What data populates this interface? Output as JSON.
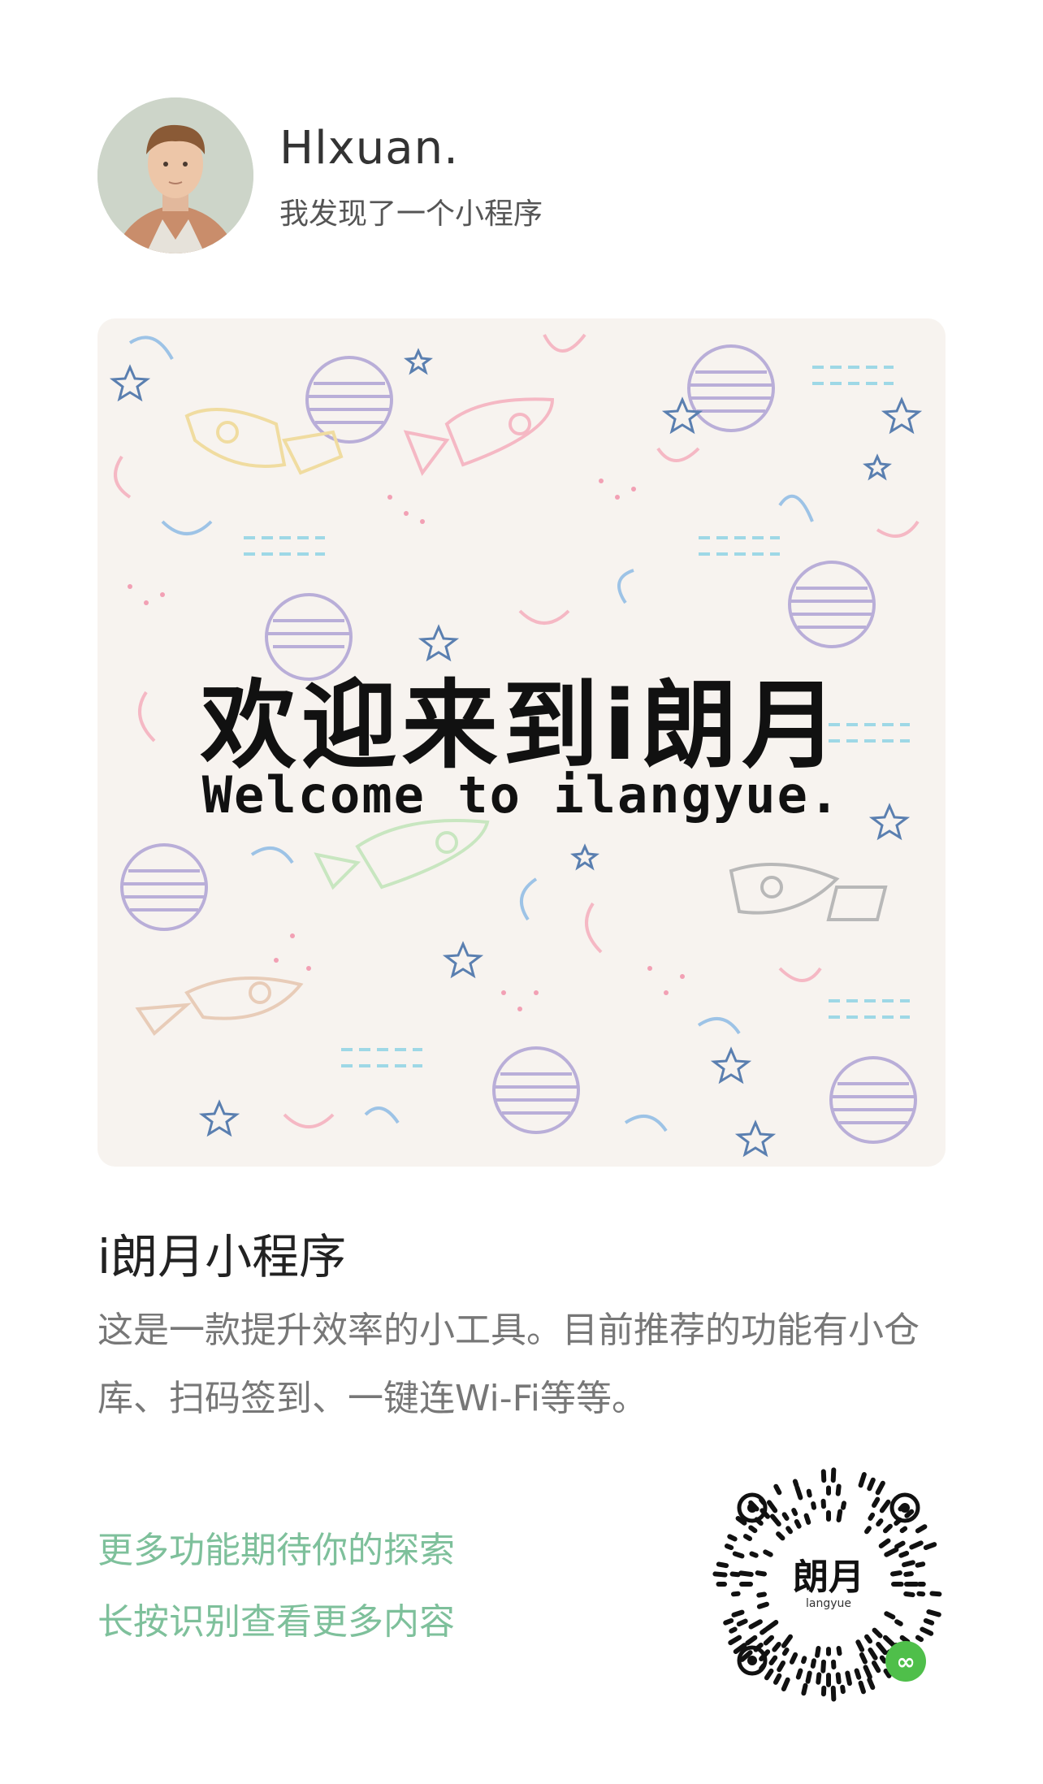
{
  "header": {
    "username": "Hlxuan.",
    "share_text": "我发现了一个小程序"
  },
  "banner": {
    "title_cn": "欢迎来到i朗月",
    "title_en": "Welcome to ilangyue."
  },
  "app": {
    "title": "i朗月小程序",
    "description": "这是一款提升效率的小工具。目前推荐的功能有小仓库、扫码签到、一键连Wi-Fi等等。"
  },
  "hints": {
    "explore": "更多功能期待你的探索",
    "long_press": "长按识别查看更多内容"
  },
  "qr": {
    "logo_text": "朗月",
    "logo_sub": "langyue"
  },
  "colors": {
    "hint_green": "#7ec09b",
    "badge_green": "#4fbf4a",
    "banner_bg": "#f7f3ef"
  },
  "icons": {
    "avatar": "user-avatar-photo",
    "mini_program_badge": "mini-program-icon"
  }
}
